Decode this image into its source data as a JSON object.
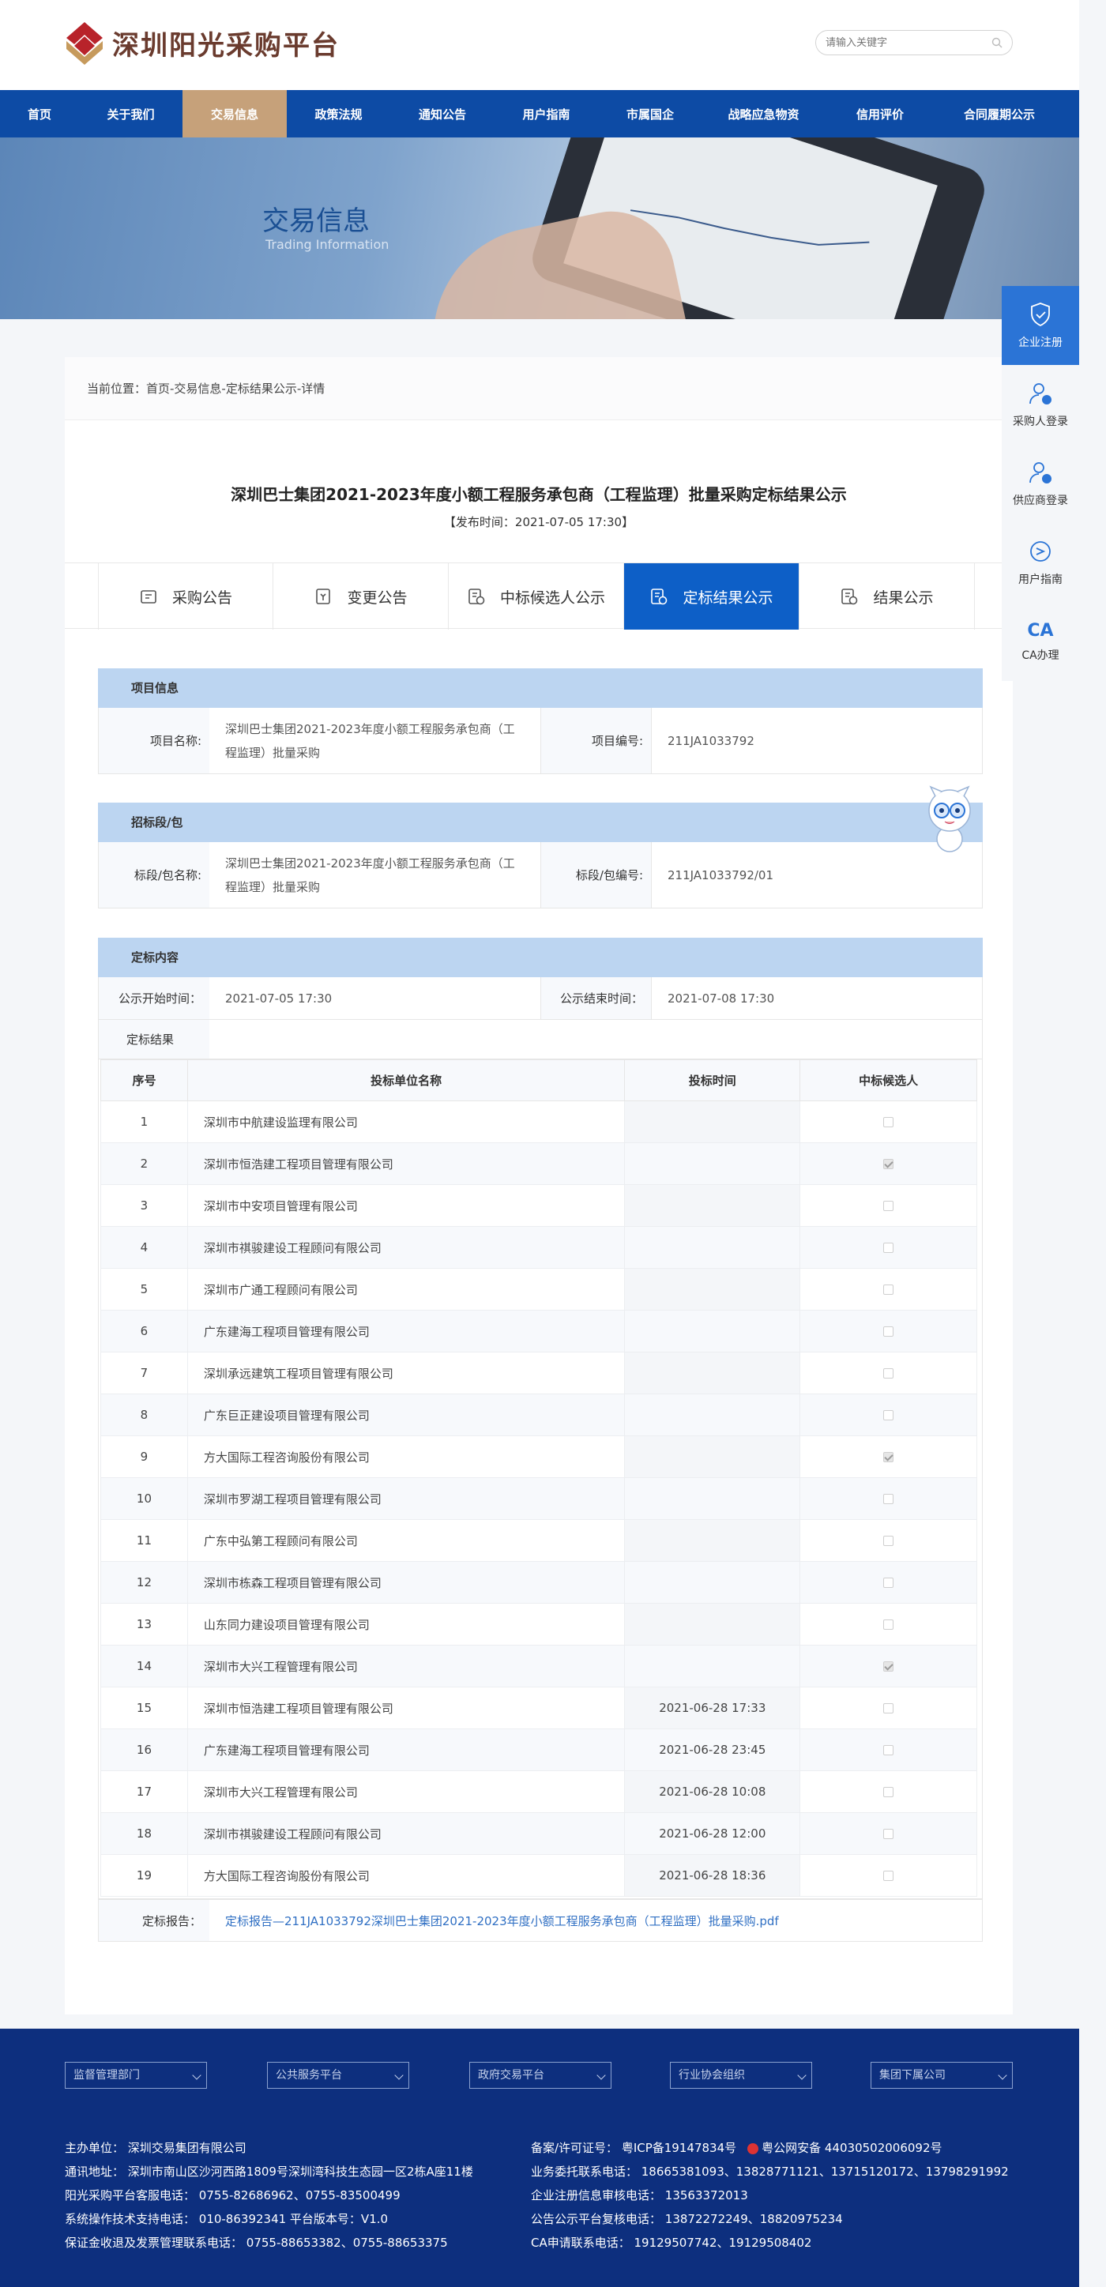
{
  "header": {
    "logo_text": "深圳阳光采购平台",
    "search_placeholder": "请输入关键字"
  },
  "nav": [
    {
      "label": "首页",
      "active": false
    },
    {
      "label": "关于我们",
      "active": false
    },
    {
      "label": "交易信息",
      "active": true
    },
    {
      "label": "政策法规",
      "active": false
    },
    {
      "label": "通知公告",
      "active": false
    },
    {
      "label": "用户指南",
      "active": false
    },
    {
      "label": "市属国企",
      "active": false
    },
    {
      "label": "战略应急物资",
      "active": false
    },
    {
      "label": "信用评价",
      "active": false
    },
    {
      "label": "合同履期公示",
      "active": false
    }
  ],
  "banner": {
    "title": "交易信息",
    "subtitle": "Trading Information"
  },
  "breadcrumb": "当前位置：首页-交易信息-定标结果公示-详情",
  "article": {
    "title": "深圳巴士集团2021-2023年度小额工程服务承包商（工程监理）批量采购定标结果公示",
    "pubtime": "【发布时间：2021-07-05 17:30】"
  },
  "tabs": [
    {
      "label": "采购公告",
      "active": false,
      "icon": "announcement-icon"
    },
    {
      "label": "变更公告",
      "active": false,
      "icon": "change-icon"
    },
    {
      "label": "中标候选人公示",
      "active": false,
      "icon": "candidate-icon"
    },
    {
      "label": "定标结果公示",
      "active": true,
      "icon": "result-icon"
    },
    {
      "label": "结果公示",
      "active": false,
      "icon": "final-result-icon"
    }
  ],
  "project_info": {
    "heading": "项目信息",
    "name_label": "项目名称:",
    "name_value": "深圳巴士集团2021-2023年度小额工程服务承包商（工程监理）批量采购",
    "code_label": "项目编号:",
    "code_value": "211JA1033792"
  },
  "section_info": {
    "heading": "招标段/包",
    "name_label": "标段/包名称:",
    "name_value": "深圳巴士集团2021-2023年度小额工程服务承包商（工程监理）批量采购",
    "code_label": "标段/包编号:",
    "code_value": "211JA1033792/01"
  },
  "award": {
    "heading": "定标内容",
    "start_label": "公示开始时间：",
    "start_value": "2021-07-05 17:30",
    "end_label": "公示结束时间：",
    "end_value": "2021-07-08 17:30",
    "result_label": "定标结果",
    "columns": [
      "序号",
      "投标单位名称",
      "投标时间",
      "中标候选人"
    ],
    "rows": [
      {
        "no": "1",
        "name": "深圳市中航建设监理有限公司",
        "time": "",
        "checked": false
      },
      {
        "no": "2",
        "name": "深圳市恒浩建工程项目管理有限公司",
        "time": "",
        "checked": true
      },
      {
        "no": "3",
        "name": "深圳市中安项目管理有限公司",
        "time": "",
        "checked": false
      },
      {
        "no": "4",
        "name": "深圳市祺骏建设工程顾问有限公司",
        "time": "",
        "checked": false
      },
      {
        "no": "5",
        "name": "深圳市广通工程顾问有限公司",
        "time": "",
        "checked": false
      },
      {
        "no": "6",
        "name": "广东建海工程项目管理有限公司",
        "time": "",
        "checked": false
      },
      {
        "no": "7",
        "name": "深圳承远建筑工程项目管理有限公司",
        "time": "",
        "checked": false
      },
      {
        "no": "8",
        "name": "广东巨正建设项目管理有限公司",
        "time": "",
        "checked": false
      },
      {
        "no": "9",
        "name": "方大国际工程咨询股份有限公司",
        "time": "",
        "checked": true
      },
      {
        "no": "10",
        "name": "深圳市罗湖工程项目管理有限公司",
        "time": "",
        "checked": false
      },
      {
        "no": "11",
        "name": "广东中弘第工程顾问有限公司",
        "time": "",
        "checked": false
      },
      {
        "no": "12",
        "name": "深圳市栋森工程项目管理有限公司",
        "time": "",
        "checked": false
      },
      {
        "no": "13",
        "name": "山东同力建设项目管理有限公司",
        "time": "",
        "checked": false
      },
      {
        "no": "14",
        "name": "深圳市大兴工程管理有限公司",
        "time": "",
        "checked": true
      },
      {
        "no": "15",
        "name": "深圳市恒浩建工程项目管理有限公司",
        "time": "2021-06-28 17:33",
        "checked": false
      },
      {
        "no": "16",
        "name": "广东建海工程项目管理有限公司",
        "time": "2021-06-28 23:45",
        "checked": false
      },
      {
        "no": "17",
        "name": "深圳市大兴工程管理有限公司",
        "time": "2021-06-28 10:08",
        "checked": false
      },
      {
        "no": "18",
        "name": "深圳市祺骏建设工程顾问有限公司",
        "time": "2021-06-28 12:00",
        "checked": false
      },
      {
        "no": "19",
        "name": "方大国际工程咨询股份有限公司",
        "time": "2021-06-28 18:36",
        "checked": false
      }
    ],
    "report_label": "定标报告：",
    "report_link": "定标报告—211JA1033792深圳巴士集团2021-2023年度小额工程服务承包商（工程监理）批量采购.pdf"
  },
  "sidebar": [
    {
      "label": "企业注册",
      "icon": "enterprise-register-icon"
    },
    {
      "label": "采购人登录",
      "icon": "purchaser-login-icon"
    },
    {
      "label": "供应商登录",
      "icon": "supplier-login-icon"
    },
    {
      "label": "用户指南",
      "icon": "user-guide-icon"
    },
    {
      "label": "CA办理",
      "icon_text": "CA"
    }
  ],
  "footer": {
    "selects": [
      "监督管理部门",
      "公共服务平台",
      "政府交易平台",
      "行业协会组织",
      "集团下属公司"
    ],
    "left_lines": [
      "主办单位：  深圳交易集团有限公司",
      "通讯地址：  深圳市南山区沙河西路1809号深圳湾科技生态园一区2栋A座11楼",
      "阳光采购平台客服电话：  0755-82686962、0755-83500499",
      "系统操作技术支持电话：  010-86392341 平台版本号：V1.0",
      "保证金收退及发票管理联系电话：  0755-88653382、0755-88653375"
    ],
    "icp": "备案/许可证号：  粤ICP备19147834号",
    "police": "粤公网安备 44030502006092号",
    "right_lines": [
      "业务委托联系电话：  18665381093、13828771121、13715120172、13798291992",
      "企业注册信息审核电话：  13563372013",
      "公告公示平台复核电话：  13872272249、18820975234",
      "CA申请联系电话：  19129507742、19129508402"
    ]
  }
}
